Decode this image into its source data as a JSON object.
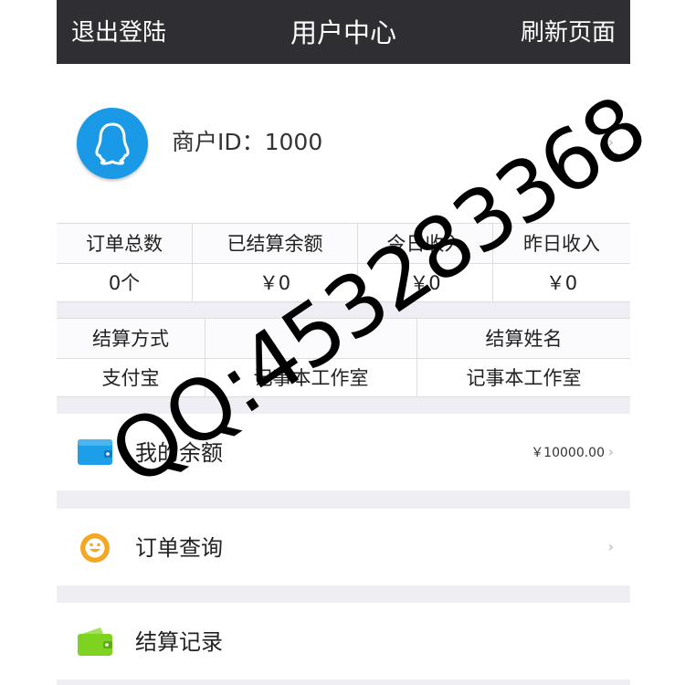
{
  "header": {
    "left_label": "退出登陆",
    "title": "用户中心",
    "right_label": "刷新页面"
  },
  "profile": {
    "merchant_id": "商户ID：1000",
    "avatar_icon": "qq-penguin-icon",
    "chevron": "›"
  },
  "stats": {
    "headers": [
      "订单总数",
      "已结算余额",
      "今日收入",
      "昨日收入"
    ],
    "values": [
      "0个",
      "￥0",
      "￥0",
      "￥0"
    ]
  },
  "settlement": {
    "headers": [
      "结算方式",
      "",
      "结算姓名"
    ],
    "values": [
      "支付宝",
      "记事本工作室",
      "记事本工作室"
    ]
  },
  "menu": {
    "balance": {
      "label": "我的余额",
      "amount": "￥10000.00",
      "chevron": "›",
      "icon": "wallet-icon"
    },
    "orders": {
      "label": "订单查询",
      "chevron": "›",
      "icon": "smiley-icon"
    },
    "records": {
      "label": "结算记录",
      "icon": "green-wallet-icon"
    }
  },
  "watermark": {
    "text": "QQ:453283368"
  },
  "colors": {
    "header_bg": "#2f2e32",
    "page_bg": "#efeef4",
    "avatar_blue": "#1a9ae6",
    "wallet_blue": "#1d9ee8",
    "smiley_orange": "#f5a623",
    "records_green": "#7ed321"
  }
}
